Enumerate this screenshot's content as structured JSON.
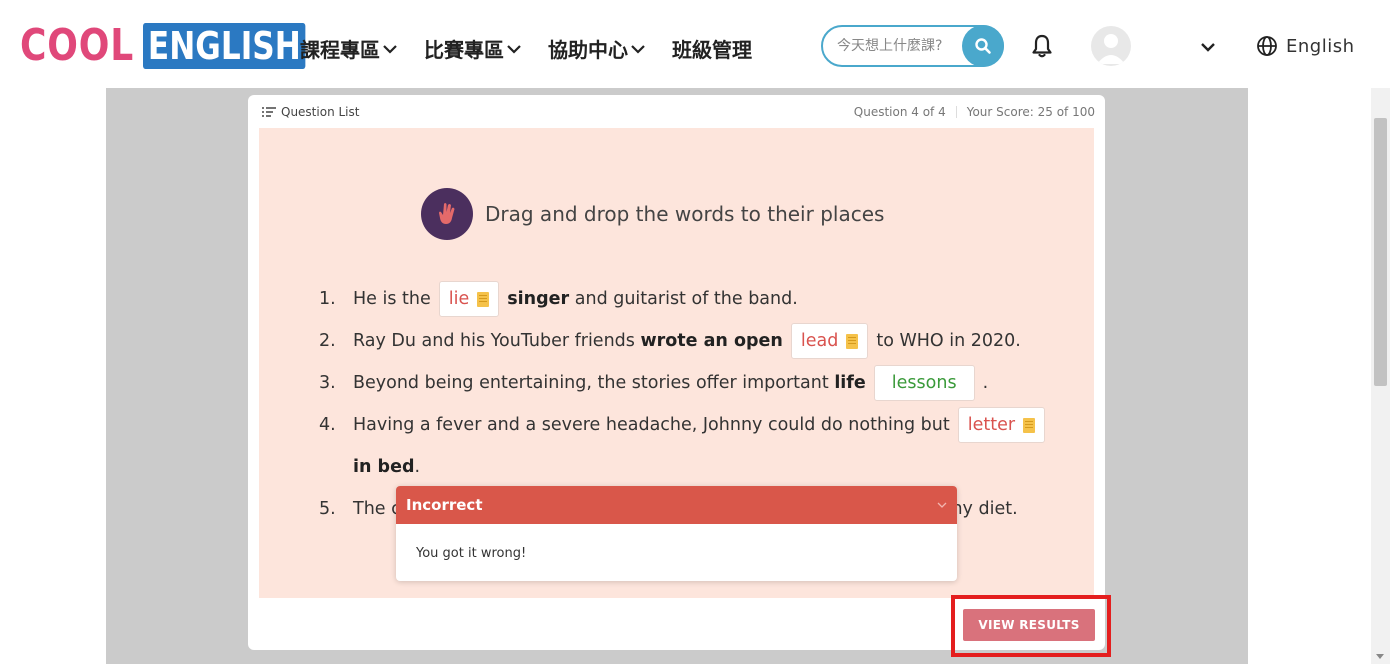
{
  "header": {
    "logo": {
      "part1": "COOL",
      "part2": "ENGLISH"
    },
    "nav": [
      {
        "label": "課程專區",
        "icon": "chevron-down-icon"
      },
      {
        "label": "比賽專區",
        "icon": "chevron-down-icon"
      },
      {
        "label": "協助中心",
        "icon": "chevron-down-icon"
      },
      {
        "label": "班級管理"
      }
    ],
    "search": {
      "placeholder": "今天想上什麼課?",
      "icon": "search-icon"
    },
    "bell_icon": "bell-icon",
    "user_menu_icon": "chevron-down-icon",
    "language": {
      "label": "English",
      "icon": "globe-icon"
    }
  },
  "quiz": {
    "question_list_label": "Question List",
    "progress": "Question 4 of 4",
    "score": "Your Score: 25 of 100",
    "instruction": "Drag and drop the words to their places",
    "items": [
      {
        "num": "1.",
        "before": "He is the",
        "chip": "lie",
        "chip_status": "wrong",
        "bold": "singer",
        "after": "and guitarist of the band."
      },
      {
        "num": "2.",
        "before": "Ray Du and his YouTuber friends",
        "bold": "wrote an open",
        "chip": "lead",
        "chip_status": "wrong",
        "after": "to WHO in 2020."
      },
      {
        "num": "3.",
        "before": "Beyond being entertaining, the stories offer important",
        "bold": "life",
        "chip": "lessons",
        "chip_status": "correct",
        "after": "."
      },
      {
        "num": "4.",
        "before": "Having a fever and a severe headache, Johnny could do nothing but",
        "chip": "letter",
        "chip_status": "wrong",
        "bold_cont": "in bed",
        "after_cont": "."
      },
      {
        "num": "5.",
        "before_visible": "The c",
        "after_visible": "lthy diet."
      }
    ],
    "feedback": {
      "title": "Incorrect",
      "message": "You got it wrong!"
    },
    "view_results_label": "VIEW RESULTS"
  },
  "colors": {
    "brand_pink": "#e0487a",
    "brand_blue": "#2b79c2",
    "search_accent": "#4aa8cc",
    "incorrect_red": "#d9574a",
    "correct_green": "#3a9a3a",
    "panel_peach": "#fde5dc",
    "button_pink": "#d9727c",
    "annotation_red": "#e41e1e"
  }
}
